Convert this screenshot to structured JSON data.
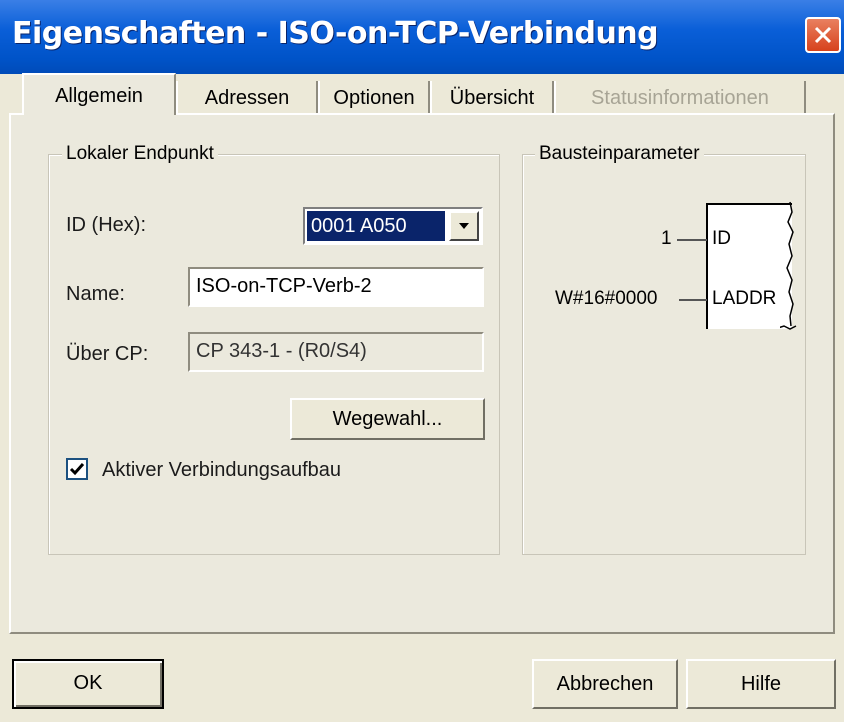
{
  "window": {
    "title": "Eigenschaften - ISO-on-TCP-Verbindung"
  },
  "tabs": [
    {
      "label": "Allgemein",
      "active": true
    },
    {
      "label": "Adressen"
    },
    {
      "label": "Optionen"
    },
    {
      "label": "Übersicht"
    },
    {
      "label": "Statusinformationen",
      "disabled": true
    }
  ],
  "local": {
    "legend": "Lokaler Endpunkt",
    "id_label": "ID (Hex):",
    "id_value": "0001 A050",
    "name_label": "Name:",
    "name_value": "ISO-on-TCP-Verb-2",
    "cp_label": "Über CP:",
    "cp_value": "CP 343-1 - (R0/S4)",
    "route_button": "Wegewahl...",
    "active_checkbox": {
      "label": "Aktiver Verbindungsaufbau",
      "checked": true
    }
  },
  "block": {
    "legend": "Bausteinparameter",
    "pin_id_value": "1",
    "pin_id": "ID",
    "pin_laddr_value": "W#16#0000",
    "pin_laddr": "LADDR"
  },
  "buttons": {
    "ok": "OK",
    "cancel": "Abbrechen",
    "help": "Hilfe"
  },
  "colors": {
    "titlebar": "#0053c8",
    "selection": "#0a246a",
    "close": "#d7421c"
  }
}
